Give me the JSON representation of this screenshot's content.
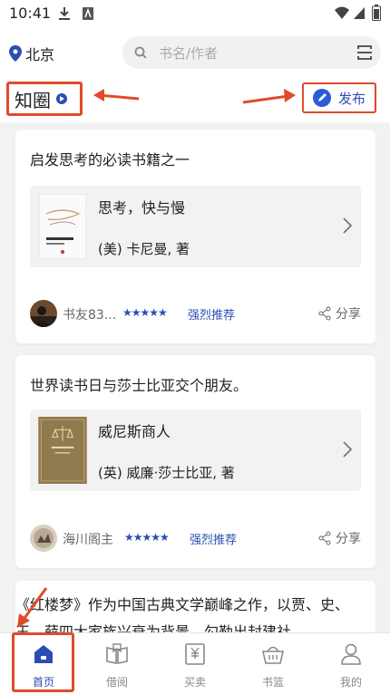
{
  "status": {
    "time": "10:41"
  },
  "location": {
    "city": "北京"
  },
  "search": {
    "placeholder": "书名/作者"
  },
  "header": {
    "title": "知圈",
    "publish_label": "发布"
  },
  "posts": [
    {
      "text": "启发思考的必读书籍之一",
      "book_title": "思考，快与慢",
      "book_author": "(美) 卡尼曼, 著",
      "user": "书友83...",
      "stars": "★★★★★",
      "recommend": "强烈推荐",
      "share_label": "分享"
    },
    {
      "text": "世界读书日与莎士比亚交个朋友。",
      "book_title": "威尼斯商人",
      "book_author": "(英) 威廉·莎士比亚, 著",
      "user": "海川阁主",
      "stars": "★★★★★",
      "recommend": "强烈推荐",
      "share_label": "分享"
    },
    {
      "text": "《红楼梦》作为中国古典文学巅峰之作，以贾、史、王、薛四大家族兴衰为背景，勾勒出封建社"
    }
  ],
  "nav": [
    {
      "label": "首页",
      "active": true
    },
    {
      "label": "借阅"
    },
    {
      "label": "买卖"
    },
    {
      "label": "书篮"
    },
    {
      "label": "我的"
    }
  ],
  "colors": {
    "accent": "#2c4db3",
    "annotation": "#e04b2a"
  }
}
